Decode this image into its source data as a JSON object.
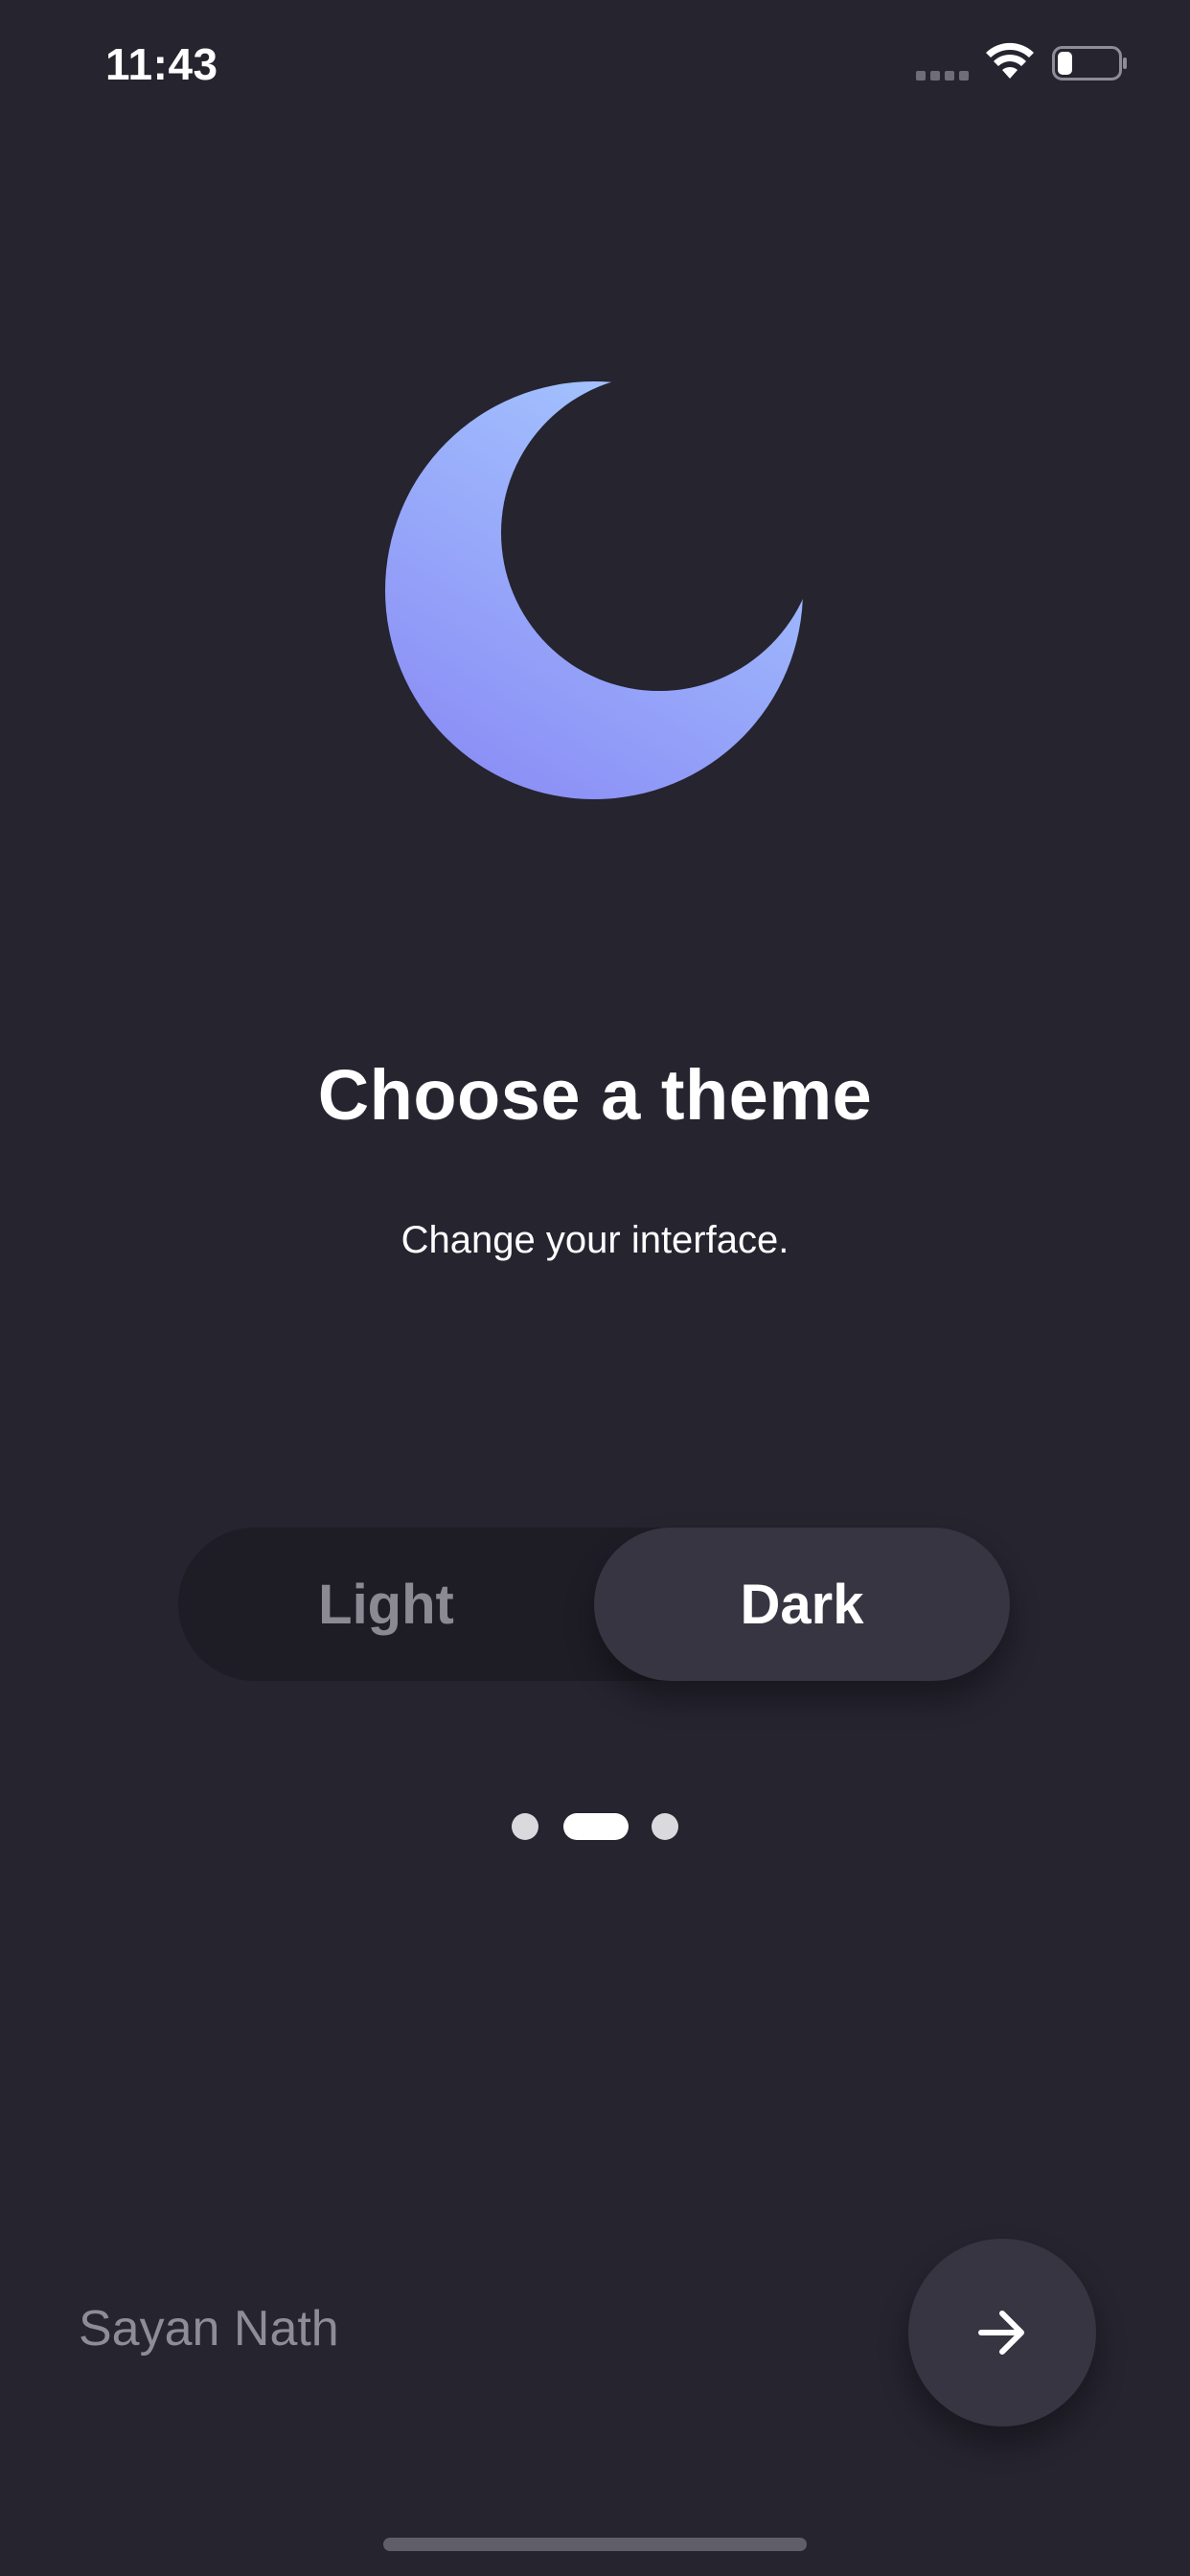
{
  "status_bar": {
    "time": "11:43",
    "icons": [
      "signal-icon",
      "wifi-icon",
      "battery-icon"
    ],
    "battery_level": 0.25
  },
  "hero": {
    "icon": "moon-icon",
    "gradient_colors": [
      "#a6c8ff",
      "#8a8cf5"
    ]
  },
  "heading": {
    "title": "Choose a theme",
    "subtitle": "Change your interface."
  },
  "theme_toggle": {
    "options": [
      "Light",
      "Dark"
    ],
    "selected": "Dark"
  },
  "pagination": {
    "pages": 3,
    "current": 2
  },
  "footer": {
    "author": "Sayan Nath",
    "next_icon": "arrow-right-icon"
  },
  "colors": {
    "background": "#25242f",
    "surface": "#363541",
    "muted_text": "#8e8d95"
  }
}
